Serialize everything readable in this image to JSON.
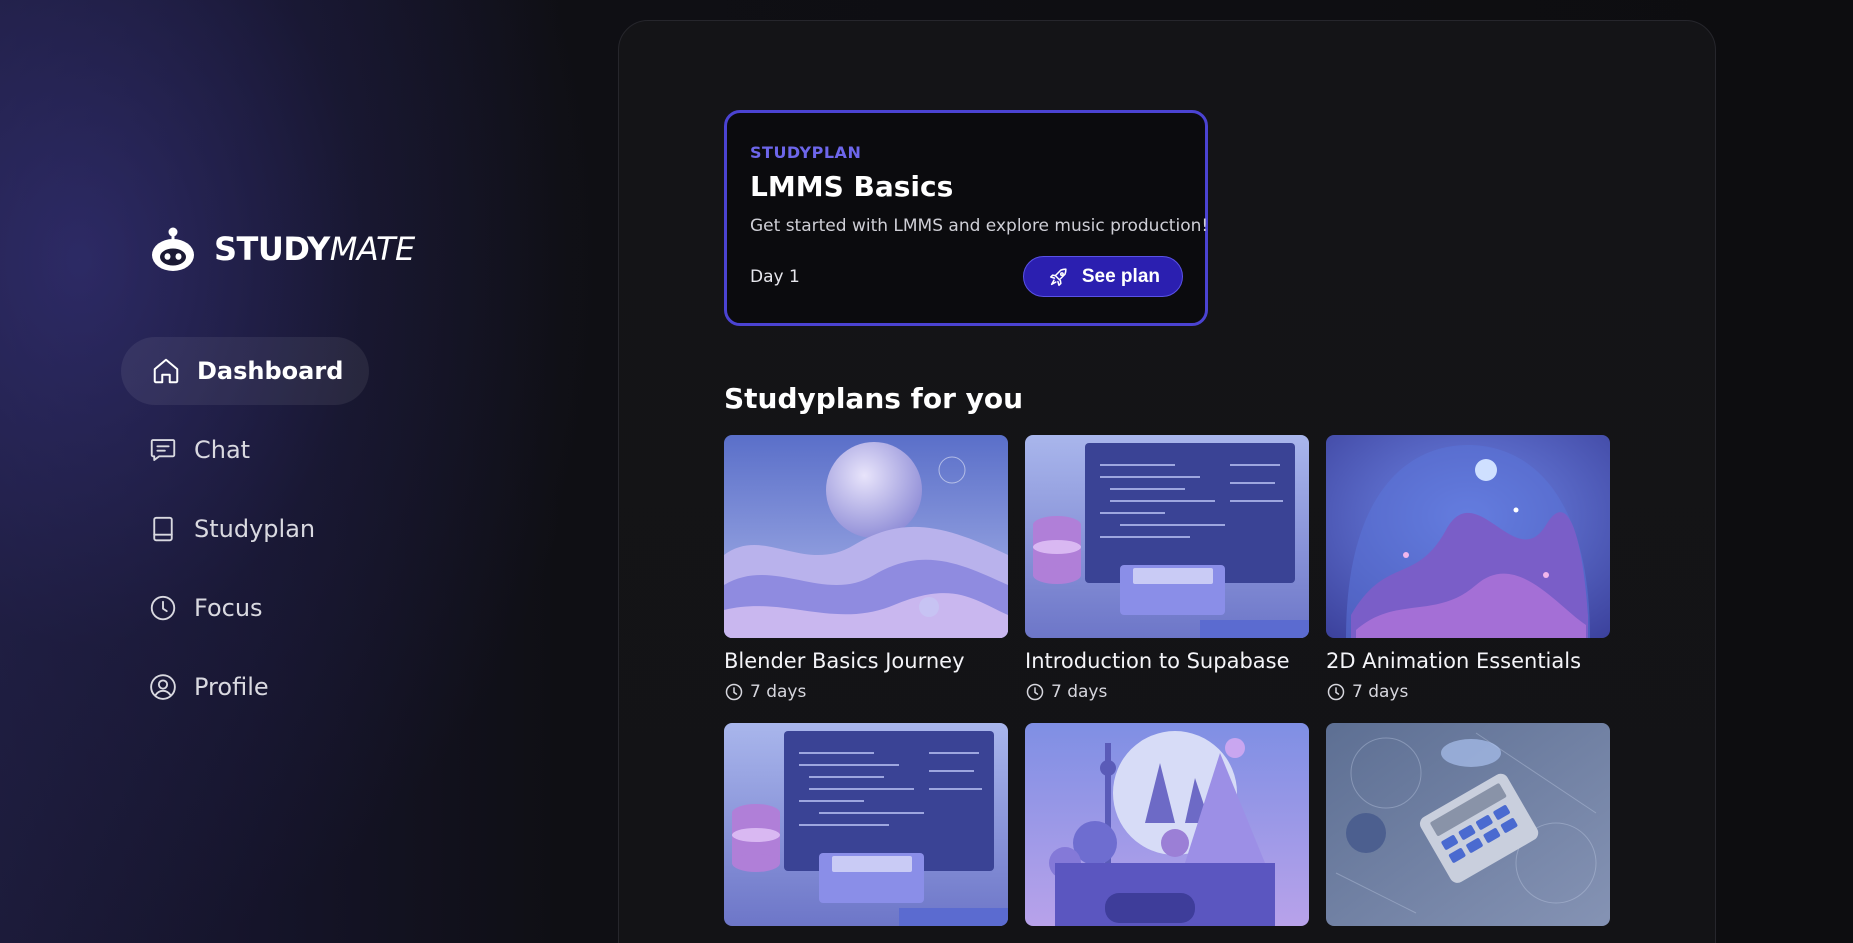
{
  "brand": {
    "name_strong": "STUDY",
    "name_italic": "MATE",
    "logo_icon": "robot-head-icon"
  },
  "nav": {
    "items": [
      {
        "label": "Dashboard",
        "icon": "home-icon",
        "active": true
      },
      {
        "label": "Chat",
        "icon": "chat-icon",
        "active": false
      },
      {
        "label": "Studyplan",
        "icon": "book-icon",
        "active": false
      },
      {
        "label": "Focus",
        "icon": "clock-icon",
        "active": false
      },
      {
        "label": "Profile",
        "icon": "user-icon",
        "active": false
      }
    ]
  },
  "featured": {
    "kicker": "STUDYPLAN",
    "title": "LMMS Basics",
    "description": "Get started with LMMS and explore music production!",
    "day": "Day 1",
    "button_label": "See plan",
    "button_icon": "rocket-icon"
  },
  "recommendations": {
    "title": "Studyplans for you",
    "cards": [
      {
        "title": "Blender Basics Journey",
        "duration": "7 days",
        "image": "abstract-spheres-waves"
      },
      {
        "title": "Introduction to Supabase",
        "duration": "7 days",
        "image": "code-screen-database"
      },
      {
        "title": "2D Animation Essentials",
        "duration": "7 days",
        "image": "dome-landscape"
      },
      {
        "title": "",
        "duration": "",
        "image": "code-screen-database"
      },
      {
        "title": "",
        "duration": "",
        "image": "city-gaming-scene"
      },
      {
        "title": "",
        "duration": "",
        "image": "calculator-math"
      }
    ]
  },
  "colors": {
    "accent": "#4b43d2",
    "accent_text": "#6d66ea",
    "button_bg": "#2b1fb0",
    "background": "#0d0d10"
  }
}
